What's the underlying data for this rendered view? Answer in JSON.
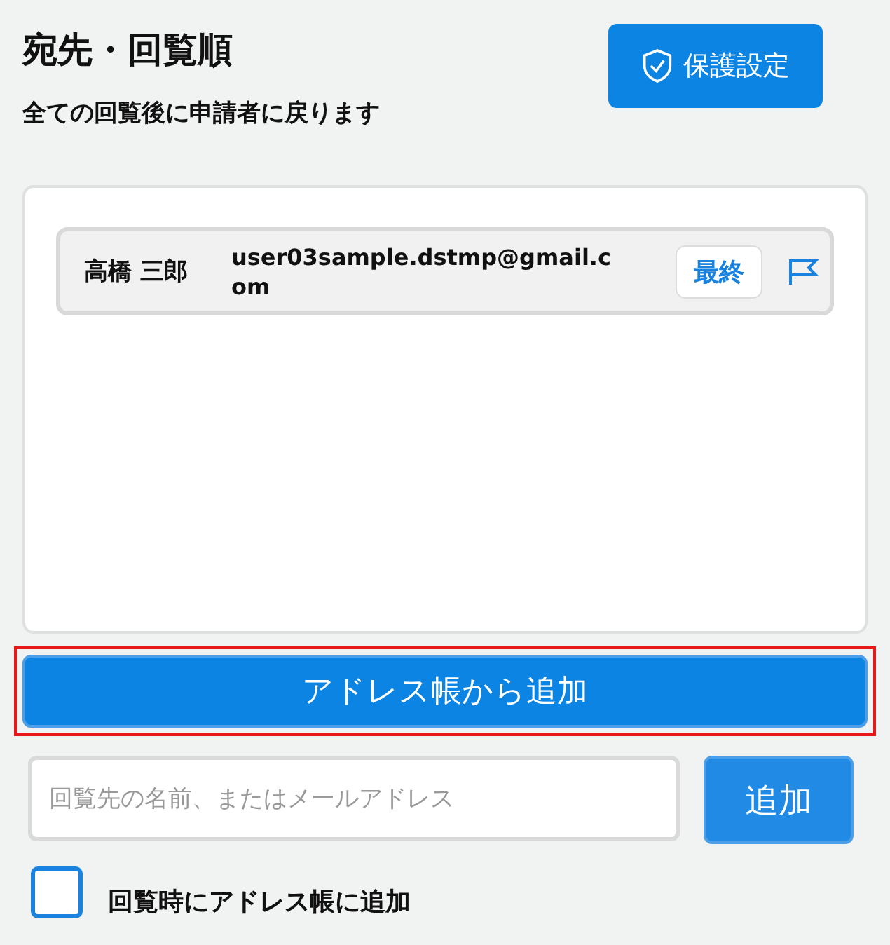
{
  "title": "宛先・回覧順",
  "protect_button": {
    "label": "保護設定"
  },
  "subtitle": "全ての回覧後に申請者に戻ります",
  "recipients": [
    {
      "name": "高橋 三郎",
      "email": "user03sample.dstmp@gmail.com",
      "badge": "最終"
    }
  ],
  "address_book_button": {
    "label": "アドレス帳から追加",
    "highlighted": true
  },
  "search": {
    "placeholder": "回覧先の名前、またはメールアドレス"
  },
  "add_button": {
    "label": "追加"
  },
  "option": {
    "label": "回覧時にアドレス帳に追加",
    "checked": false
  }
}
